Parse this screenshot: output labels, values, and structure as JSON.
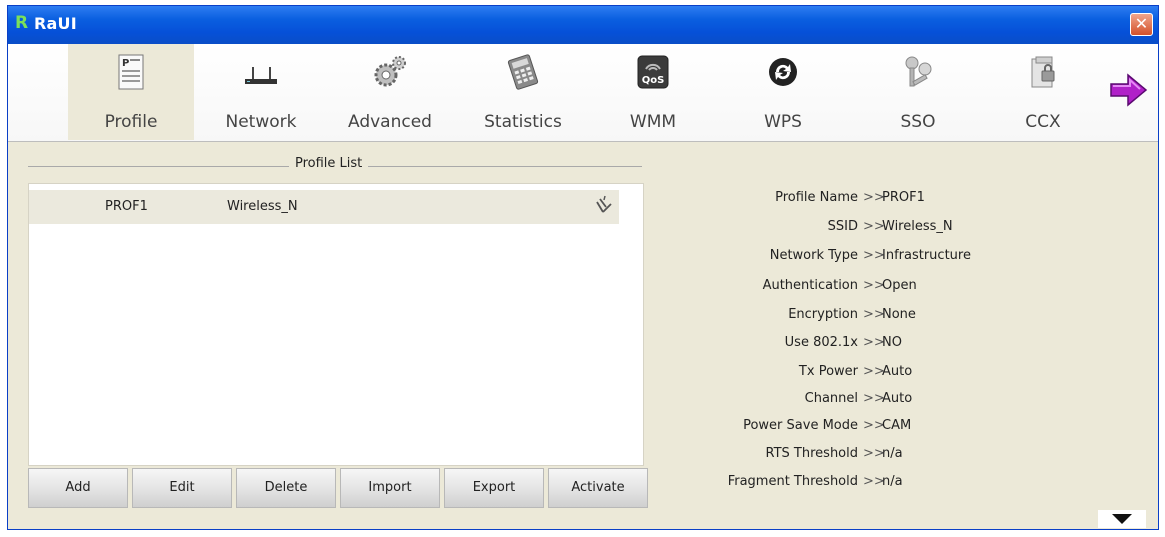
{
  "window": {
    "title": "RaUI",
    "logo_letter": "R"
  },
  "toolbar": {
    "items": [
      {
        "label": "Profile",
        "icon": "profile-icon"
      },
      {
        "label": "Network",
        "icon": "network-icon"
      },
      {
        "label": "Advanced",
        "icon": "gears-icon"
      },
      {
        "label": "Statistics",
        "icon": "calculator-icon"
      },
      {
        "label": "WMM",
        "icon": "qos-icon",
        "icon_text": "QoS"
      },
      {
        "label": "WPS",
        "icon": "wps-icon"
      },
      {
        "label": "SSO",
        "icon": "sso-keys-icon"
      },
      {
        "label": "CCX",
        "icon": "ccx-icon"
      }
    ],
    "selected": "Profile"
  },
  "profile_list": {
    "title": "Profile List",
    "rows": [
      {
        "name": "PROF1",
        "ssid": "Wireless_N"
      }
    ]
  },
  "buttons": {
    "add": "Add",
    "edit": "Edit",
    "delete": "Delete",
    "import": "Import",
    "export": "Export",
    "activate": "Activate"
  },
  "details": {
    "separator": ">>",
    "rows": [
      {
        "label": "Profile Name",
        "value": "PROF1"
      },
      {
        "label": "SSID",
        "value": "Wireless_N"
      },
      {
        "label": "Network Type",
        "value": "Infrastructure"
      },
      {
        "label": "Authentication",
        "value": "Open"
      },
      {
        "label": "Encryption",
        "value": "None"
      },
      {
        "label": "Use 802.1x",
        "value": "NO"
      },
      {
        "label": "Tx Power",
        "value": "Auto"
      },
      {
        "label": "Channel",
        "value": "Auto"
      },
      {
        "label": "Power Save Mode",
        "value": "CAM"
      },
      {
        "label": "RTS Threshold",
        "value": "n/a"
      },
      {
        "label": "Fragment Threshold",
        "value": "n/a"
      }
    ]
  },
  "colors": {
    "titlebar": "#0a5fe0",
    "window_bg": "#ece9d8",
    "list_row": "#ebe9dd",
    "next_arrow": "#b020c8"
  }
}
